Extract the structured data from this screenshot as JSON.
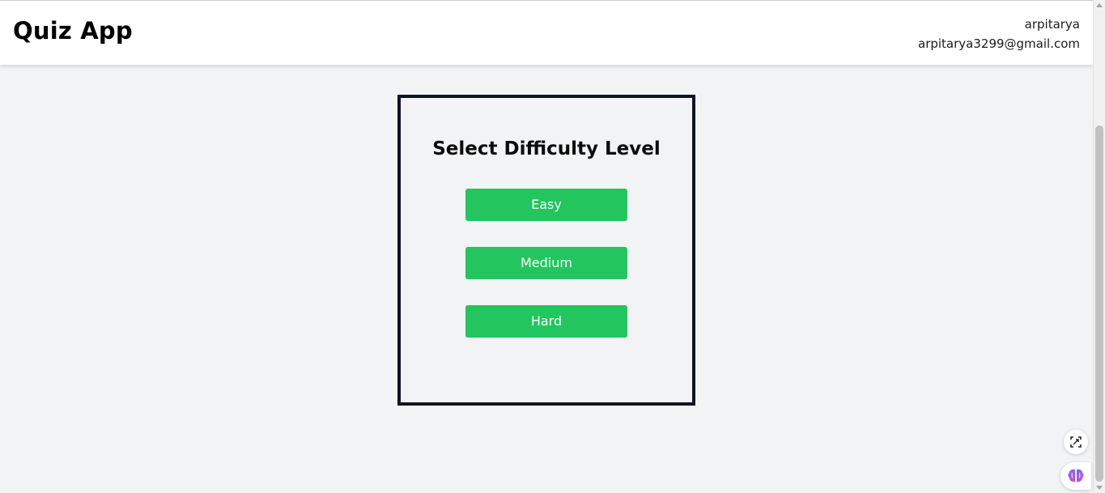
{
  "header": {
    "app_title": "Quiz App",
    "username": "arpitarya",
    "email": "arpitarya3299@gmail.com"
  },
  "difficulty": {
    "title": "Select Difficulty Level",
    "levels": [
      {
        "label": "Easy"
      },
      {
        "label": "Medium"
      },
      {
        "label": "Hard"
      }
    ],
    "button_color": "#22c55e",
    "border_color": "#0f1425"
  },
  "floating": {
    "capture_icon": "screen-capture-icon",
    "brain_icon": "brain-extension-icon"
  }
}
